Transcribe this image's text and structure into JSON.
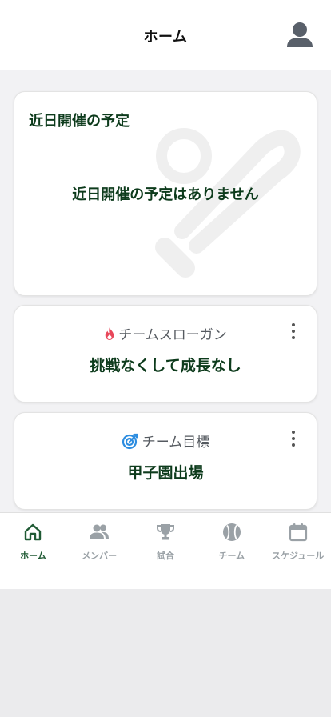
{
  "header": {
    "title": "ホーム",
    "profile_icon": "user-icon"
  },
  "events": {
    "title": "近日開催の予定",
    "empty_message": "近日開催の予定はありません",
    "watermark_icon": "baseball-bat-icon"
  },
  "slogan": {
    "label": "チームスローガン",
    "icon": "flame-icon",
    "value": "挑戦なくして成長なし",
    "icon_color": "#e8475a"
  },
  "goal": {
    "label": "チーム目標",
    "icon": "target-icon",
    "value": "甲子園出場",
    "icon_color": "#2d8de0"
  },
  "tabs": [
    {
      "label": "ホーム",
      "icon": "home-icon",
      "active": true
    },
    {
      "label": "メンバー",
      "icon": "people-icon",
      "active": false
    },
    {
      "label": "試合",
      "icon": "trophy-icon",
      "active": false
    },
    {
      "label": "チーム",
      "icon": "baseball-icon",
      "active": false
    },
    {
      "label": "スケジュール",
      "icon": "calendar-icon",
      "active": false
    }
  ],
  "colors": {
    "accent": "#1f5a34",
    "text_dark": "#0d3b1c",
    "inactive": "#9aa1a6"
  }
}
